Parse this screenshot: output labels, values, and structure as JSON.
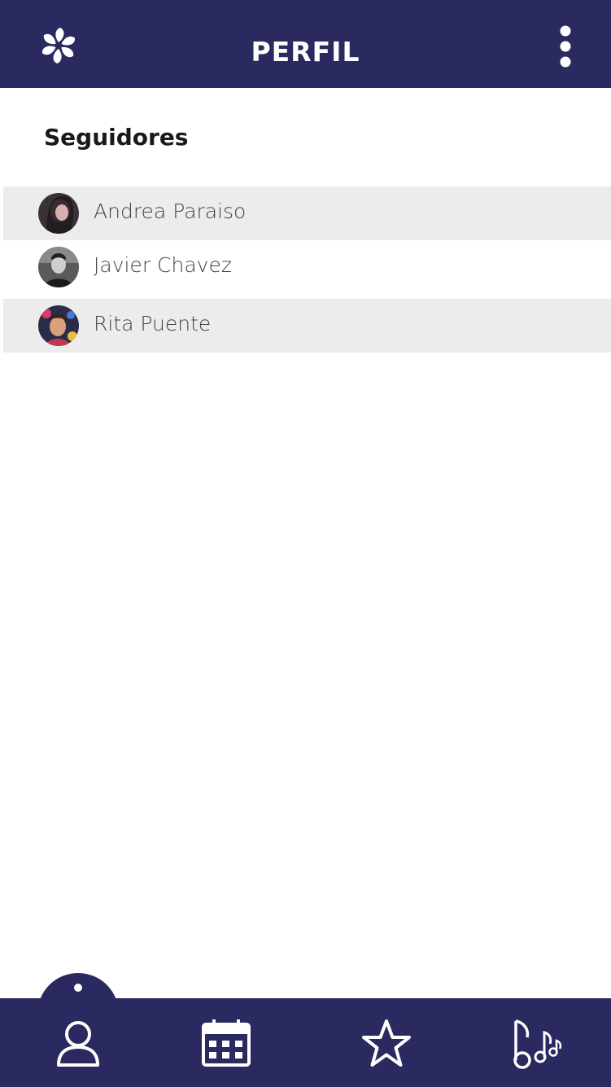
{
  "header": {
    "title": "PERFIL",
    "logo_icon": "pinwheel-logo-icon",
    "menu_icon": "more-vertical-icon",
    "background_color": "#2a2960"
  },
  "section": {
    "title": "Seguidores"
  },
  "followers": [
    {
      "name": "Andrea Paraiso",
      "avatar": "avatar-photo-andrea"
    },
    {
      "name": "Javier Chavez",
      "avatar": "avatar-photo-javier"
    },
    {
      "name": "Rita Puente",
      "avatar": "avatar-photo-rita"
    }
  ],
  "bottom_nav": {
    "active": "profile",
    "items": [
      {
        "id": "profile",
        "icon": "user-icon"
      },
      {
        "id": "calendar",
        "icon": "calendar-icon"
      },
      {
        "id": "favorites",
        "icon": "star-icon"
      },
      {
        "id": "music",
        "icon": "music-notes-icon"
      }
    ],
    "background_color": "#2a2960"
  }
}
